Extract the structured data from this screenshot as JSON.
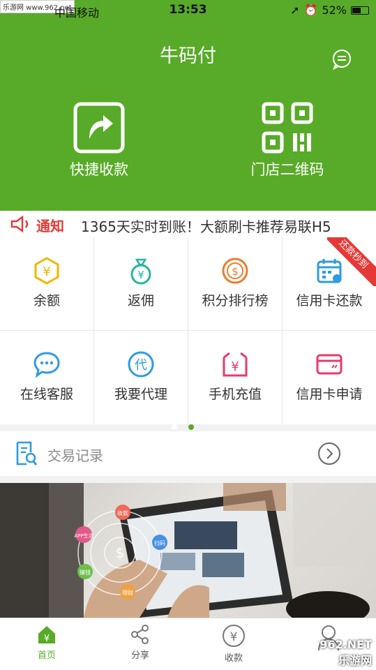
{
  "status": {
    "carrier": "中国移动",
    "time": "13:53",
    "battery": "52%",
    "watermark": "乐游网 www.962.net"
  },
  "header": {
    "title": "牛码付",
    "quick_collect": "快捷收款",
    "store_qr": "门店二维码"
  },
  "notice": {
    "label": "通知",
    "text": "1365天实时到账！大额刷卡推荐易联H5"
  },
  "grid": {
    "items": [
      {
        "label": "余额",
        "icon": "yen-hexagon-icon",
        "color": "#f2b600"
      },
      {
        "label": "返佣",
        "icon": "money-bag-icon",
        "color": "#26b5a0"
      },
      {
        "label": "积分排行榜",
        "icon": "coin-dollar-icon",
        "color": "#f07a2d"
      },
      {
        "label": "信用卡还款",
        "icon": "calendar-icon",
        "color": "#2f9be0",
        "badge": "还款秒到"
      },
      {
        "label": "在线客服",
        "icon": "chat-bubble-icon",
        "color": "#2f9be0"
      },
      {
        "label": "我要代理",
        "icon": "agent-icon",
        "color": "#2f9be0",
        "glyph": "代"
      },
      {
        "label": "手机充值",
        "icon": "recharge-icon",
        "color": "#e53b6d",
        "glyph": "¥"
      },
      {
        "label": "信用卡申请",
        "icon": "credit-card-icon",
        "color": "#e53b6d"
      }
    ],
    "page_indicator": {
      "count": 2,
      "active": 2
    }
  },
  "transactions": {
    "label": "交易记录"
  },
  "banner": {
    "nodes": [
      "收款",
      "扫码",
      "理财",
      "赚钱",
      "APP生活"
    ]
  },
  "tabbar": {
    "items": [
      {
        "label": "首页",
        "icon": "home-yen-icon",
        "active": true
      },
      {
        "label": "分享",
        "icon": "share-icon",
        "active": false
      },
      {
        "label": "收款",
        "icon": "yen-circle-icon",
        "active": false
      },
      {
        "label": "",
        "icon": "user-icon",
        "active": false
      }
    ]
  },
  "watermark_br": "962.NET 乐游网",
  "colors": {
    "brand_green": "#58ab28",
    "notice_red": "#e53935"
  }
}
